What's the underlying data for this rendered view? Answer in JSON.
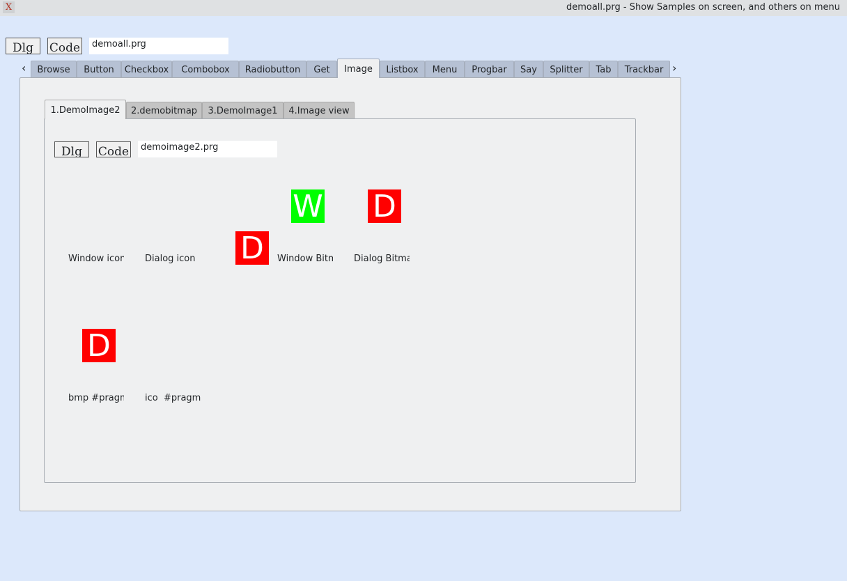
{
  "window": {
    "title": "demoall.prg - Show Samples on screen, and others on menu",
    "icon": "X"
  },
  "toolbar": {
    "dlg": "Dlg",
    "code": "Code",
    "file": "demoall.prg"
  },
  "tabs": [
    "Browse",
    "Button",
    "Checkbox",
    "Combobox",
    "Radiobutton",
    "Get",
    "Image",
    "Listbox",
    "Menu",
    "Progbar",
    "Say",
    "Splitter",
    "Tab",
    "Trackbar"
  ],
  "active_tab": "Image",
  "nav": {
    "left": "‹",
    "right": "›"
  },
  "inner_tabs": [
    "1.DemoImage2",
    "2.demobitmap",
    "3.DemoImage1",
    "4.Image view"
  ],
  "inner_toolbar": {
    "dlg": "Dlg",
    "code": "Code",
    "file": "demoimage2.prg"
  },
  "images": {
    "w": "W",
    "d1": "D",
    "d2": "D",
    "d3": "D",
    "green": "#00ff00",
    "red": "#ff0000"
  },
  "labels": [
    "Window icon",
    "Dialog icon",
    "Window Bitmap",
    "Dialog Bitmap",
    "bmp #pragma",
    "ico  #pragma"
  ]
}
